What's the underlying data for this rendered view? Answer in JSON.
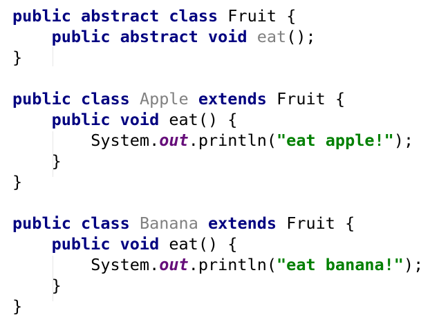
{
  "code": {
    "line1": {
      "kw1": "public",
      "kw2": "abstract",
      "kw3": "class",
      "name": "Fruit",
      "brace": "{"
    },
    "line2": {
      "kw1": "public",
      "kw2": "abstract",
      "kw3": "void",
      "method": "eat",
      "rest": "();"
    },
    "line3": {
      "brace": "}"
    },
    "line5": {
      "kw1": "public",
      "kw2": "class",
      "name": "Apple",
      "kw3": "extends",
      "parent": "Fruit",
      "brace": "{"
    },
    "line6": {
      "kw1": "public",
      "kw2": "void",
      "sig": "eat() {"
    },
    "line7": {
      "obj": "System.",
      "field": "out",
      "call": ".println(",
      "str": "\"eat apple!\"",
      "end": ");"
    },
    "line8": {
      "brace": "}"
    },
    "line9": {
      "brace": "}"
    },
    "line11": {
      "kw1": "public",
      "kw2": "class",
      "name": "Banana",
      "kw3": "extends",
      "parent": "Fruit",
      "brace": "{"
    },
    "line12": {
      "kw1": "public",
      "kw2": "void",
      "sig": "eat() {"
    },
    "line13": {
      "obj": "System.",
      "field": "out",
      "call": ".println(",
      "str": "\"eat banana!\"",
      "end": ");"
    },
    "line14": {
      "brace": "}"
    },
    "line15": {
      "brace": "}"
    }
  },
  "colors": {
    "keyword": "#000080",
    "unused_identifier": "#808080",
    "static_field": "#660e7a",
    "string_literal": "#008000",
    "background": "#ffffff"
  }
}
